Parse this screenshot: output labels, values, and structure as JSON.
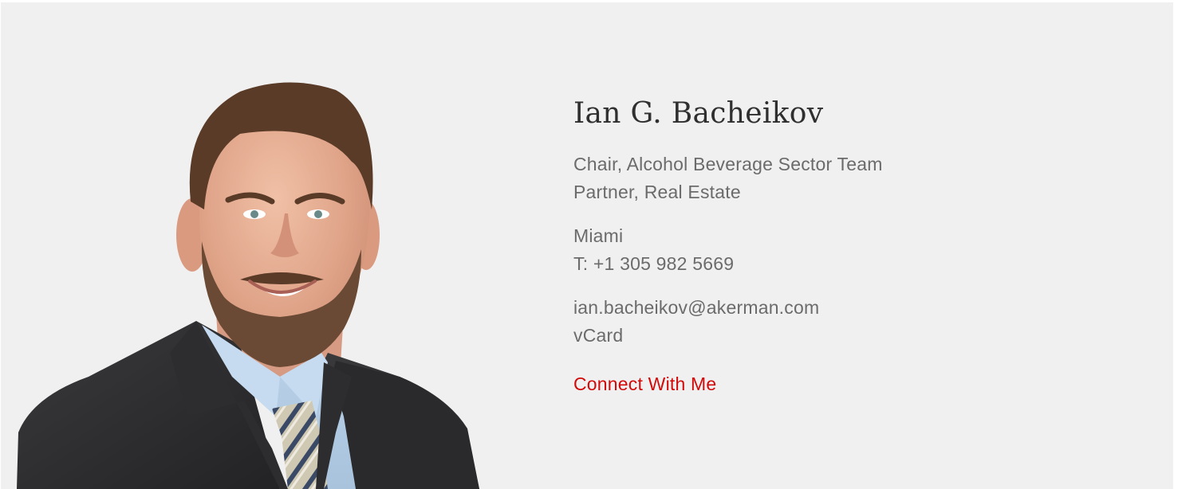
{
  "profile": {
    "name": "Ian G. Bacheikov",
    "titles": [
      "Chair, Alcohol Beverage Sector Team",
      "Partner, Real Estate"
    ],
    "office": "Miami",
    "phone": "T: +1 305 982 5669",
    "email": "ian.bacheikov@akerman.com",
    "vcard": "vCard",
    "connect_label": "Connect With Me"
  },
  "colors": {
    "background": "#f0f0f0",
    "name_text": "#2f2f2f",
    "body_text": "#6b6b6b",
    "accent": "#d20a0a"
  },
  "portrait": {
    "icon": "portrait-photo"
  }
}
